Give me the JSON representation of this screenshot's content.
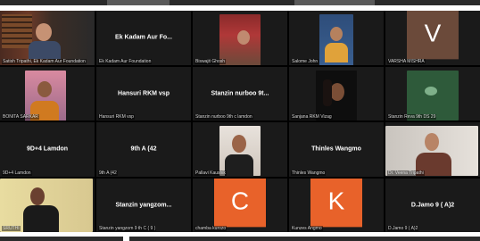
{
  "meeting": {
    "tiles": [
      {
        "id": 0,
        "name": "Satish Tripathi, Ek Kadam Aur Foundation",
        "type": "video"
      },
      {
        "id": 1,
        "name": "Ek Kadam Aur Foundation",
        "center": "Ek Kadam Aur Fo...",
        "type": "text"
      },
      {
        "id": 2,
        "name": "Biswajit Ghosh",
        "type": "video"
      },
      {
        "id": 3,
        "name": "Salome John",
        "type": "video"
      },
      {
        "id": 4,
        "name": "VARSHA MISHRA",
        "type": "avatar",
        "letter": "V",
        "color": "#6b4a3a"
      },
      {
        "id": 5,
        "name": "BONITA SARKAR",
        "type": "video"
      },
      {
        "id": 6,
        "name": "Hansuri RKM vsp",
        "center": "Hansuri RKM vsp",
        "type": "text"
      },
      {
        "id": 7,
        "name": "Stanzin nurboo 9th c lamdon",
        "center": "Stanzin nurboo  9t...",
        "type": "text"
      },
      {
        "id": 8,
        "name": "Sanjana RKM Vizag",
        "type": "video"
      },
      {
        "id": 9,
        "name": "Stanzin Reva 9th DS 29",
        "type": "video"
      },
      {
        "id": 10,
        "name": "9D+4 Lamdon",
        "center": "9D+4 Lamdon",
        "type": "text"
      },
      {
        "id": 11,
        "name": "9th  A  (42",
        "center": "9th  A  (42",
        "type": "text"
      },
      {
        "id": 12,
        "name": "Pallavi Kaushik",
        "type": "video"
      },
      {
        "id": 13,
        "name": "Thinles Wangmo",
        "center": "Thinles Wangmo",
        "type": "text"
      },
      {
        "id": 14,
        "name": "Dr. Veena Tripathi",
        "type": "video"
      },
      {
        "id": 15,
        "name": "SRUTHI",
        "type": "video"
      },
      {
        "id": 16,
        "name": "Stanzin yangzom 9 th C ( 9 )",
        "center": "Stanzin yangzom...",
        "type": "text"
      },
      {
        "id": 17,
        "name": "chamba kurozo",
        "type": "avatar",
        "letter": "C",
        "color": "#e8622a"
      },
      {
        "id": 18,
        "name": "Kunzes Angmo",
        "type": "avatar",
        "letter": "K",
        "color": "#e8622a"
      },
      {
        "id": 19,
        "name": "D.Jamo 9 ( A)2",
        "center": "D.Jamo 9 ( A)2",
        "type": "text"
      }
    ]
  }
}
